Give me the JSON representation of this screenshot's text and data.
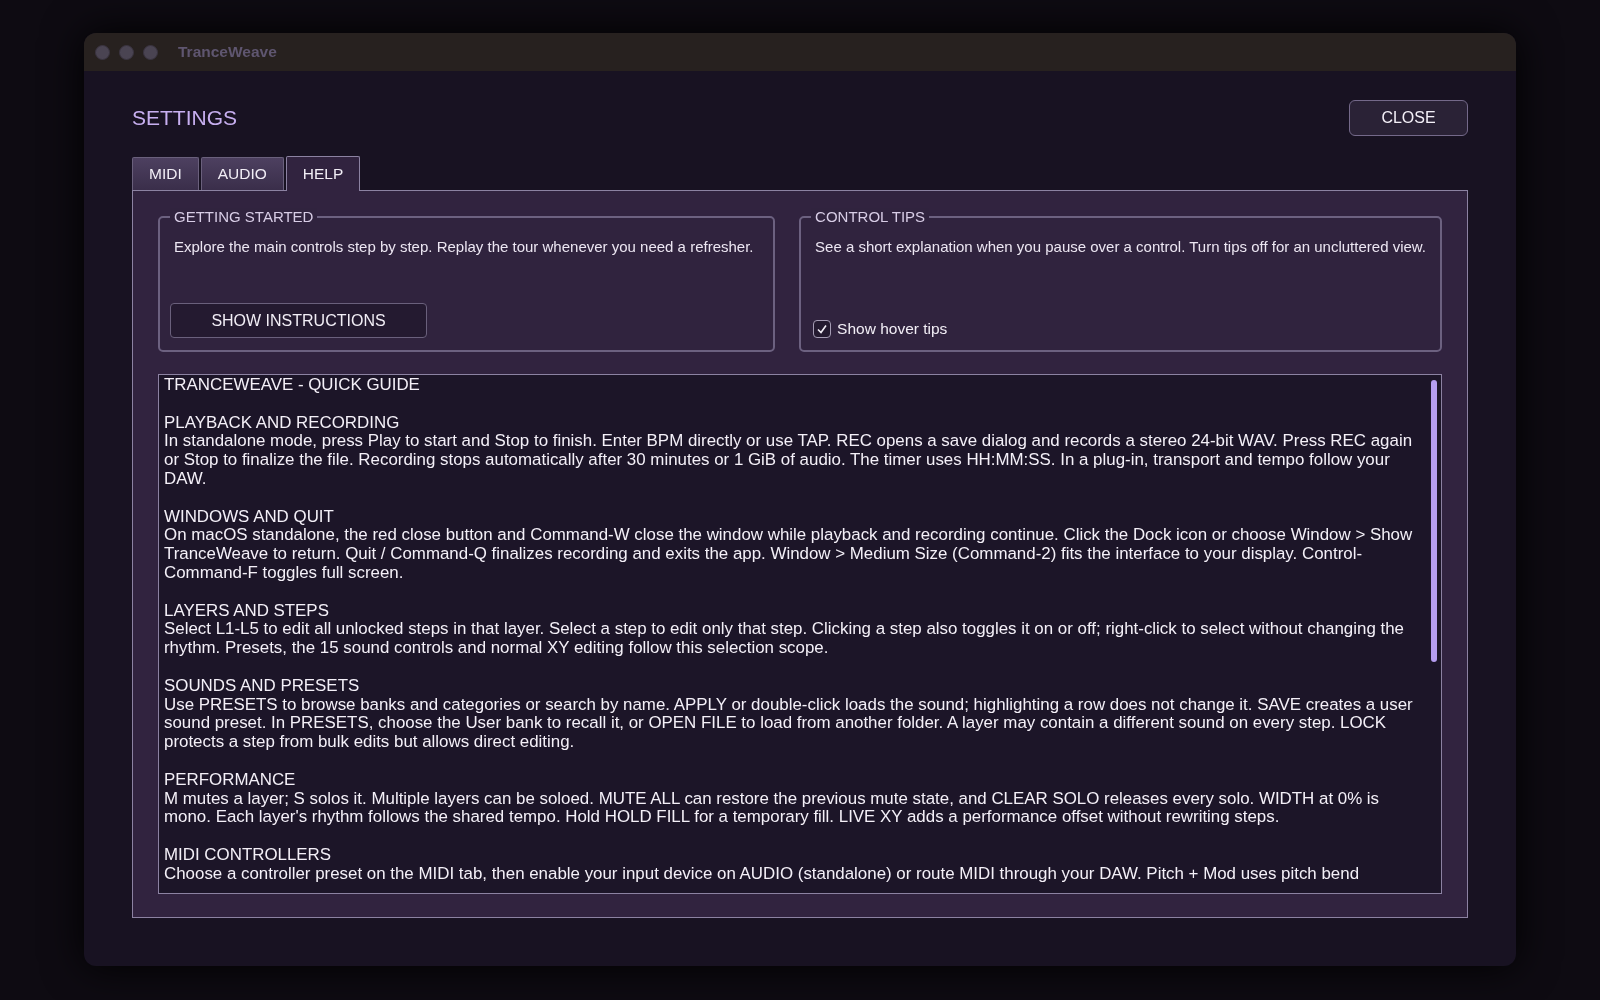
{
  "window": {
    "title": "TranceWeave"
  },
  "dialog": {
    "title": "SETTINGS",
    "close_button": "CLOSE"
  },
  "tabs": [
    {
      "label": "MIDI",
      "selected": false
    },
    {
      "label": "AUDIO",
      "selected": false
    },
    {
      "label": "HELP",
      "selected": true
    }
  ],
  "groups": [
    {
      "kind": "button",
      "title": "GETTING STARTED",
      "description": "Explore the main controls step by step. Replay the tour whenever you need a refresher.",
      "button": "SHOW INSTRUCTIONS"
    },
    {
      "kind": "checkbox",
      "title": "CONTROL TIPS",
      "description": "See a short explanation when you pause over a control. Turn tips off for an uncluttered view.",
      "checkbox": {
        "label": "Show hover tips",
        "checked": true
      }
    }
  ],
  "guide": {
    "title": "TRANCEWEAVE - QUICK GUIDE",
    "sections": [
      {
        "heading": "PLAYBACK AND RECORDING",
        "body": "In standalone mode, press Play to start and Stop to finish. Enter BPM directly or use TAP. REC opens a save dialog and records a stereo 24-bit WAV. Press REC again or Stop to finalize the file. Recording stops automatically after 30 minutes or 1 GiB of audio. The timer uses HH:MM:SS. In a plug-in, transport and tempo follow your DAW."
      },
      {
        "heading": "WINDOWS AND QUIT",
        "body": "On macOS standalone, the red close button and Command-W close the window while playback and recording continue. Click the Dock icon or choose Window > Show TranceWeave to return. Quit / Command-Q finalizes recording and exits the app. Window > Medium Size (Command-2) fits the interface to your display. Control-Command-F toggles full screen."
      },
      {
        "heading": "LAYERS AND STEPS",
        "body": "Select L1-L5 to edit all unlocked steps in that layer. Select a step to edit only that step. Clicking a step also toggles it on or off; right-click to select without changing the rhythm. Presets, the 15 sound controls and normal XY editing follow this selection scope."
      },
      {
        "heading": "SOUNDS AND PRESETS",
        "body": "Use PRESETS to browse banks and categories or search by name. APPLY or double-click loads the sound; highlighting a row does not change it. SAVE creates a user sound preset. In PRESETS, choose the User bank to recall it, or OPEN FILE to load from another folder. A layer may contain a different sound on every step. LOCK protects a step from bulk edits but allows direct editing."
      },
      {
        "heading": "PERFORMANCE",
        "body": "M mutes a layer; S solos it. Multiple layers can be soloed. MUTE ALL can restore the previous mute state, and CLEAR SOLO releases every solo. WIDTH at 0% is mono. Each layer's rhythm follows the shared tempo. Hold HOLD FILL for a temporary fill. LIVE XY adds a performance offset without rewriting steps."
      },
      {
        "heading": "MIDI CONTROLLERS",
        "body": "Choose a controller preset on the MIDI tab, then enable your input device on AUDIO (standalone) or route MIDI through your DAW. Pitch + Mod uses pitch bend"
      }
    ]
  }
}
